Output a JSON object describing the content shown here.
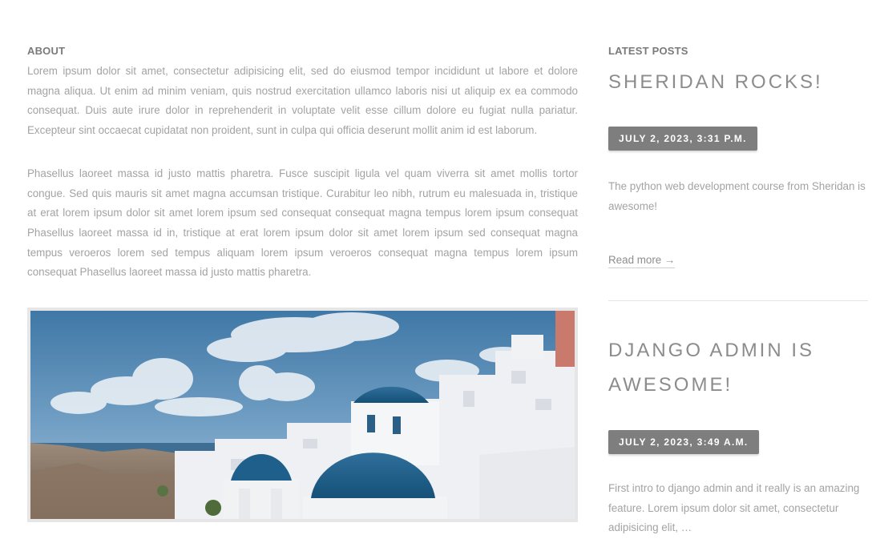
{
  "about": {
    "heading": "ABOUT",
    "paragraphs": [
      "Lorem ipsum dolor sit amet, consectetur adipisicing elit, sed do eiusmod tempor incididunt ut labore et dolore magna aliqua. Ut enim ad minim veniam, quis nostrud exercitation ullamco laboris nisi ut aliquip ex ea commodo consequat. Duis aute irure dolor in reprehenderit in voluptate velit esse cillum dolore eu fugiat nulla pariatur. Excepteur sint occaecat cupidatat non proident, sunt in culpa qui officia deserunt mollit anim id est laborum.",
      "Phasellus laoreet massa id justo mattis pharetra. Fusce suscipit ligula vel quam viverra sit amet mollis tortor congue. Sed quis mauris sit amet magna accumsan tristique. Curabitur leo nibh, rutrum eu malesuada in, tristique at erat lorem ipsum dolor sit amet lorem ipsum sed consequat consequat magna tempus lorem ipsum consequat Phasellus laoreet massa id in, tristique at erat lorem ipsum dolor sit amet lorem ipsum sed consequat magna tempus veroeros lorem sed tempus aliquam lorem ipsum veroeros consequat magna tempus lorem ipsum consequat Phasellus laoreet massa id justo mattis pharetra."
    ]
  },
  "latest_posts": {
    "heading": "LATEST POSTS",
    "posts": [
      {
        "title": "SHERIDAN ROCKS!",
        "date": "JULY 2, 2023, 3:31 P.M.",
        "excerpt": "The python web development course from Sheridan is awesome!",
        "read_more": "Read more →"
      },
      {
        "title": "DJANGO ADMIN IS AWESOME!",
        "date": "JULY 2, 2023, 3:49 A.M.",
        "excerpt": "First intro to django admin and it really is an amazing feature. Lorem ipsum dolor sit amet, consectetur adipisicing elit, …"
      }
    ]
  },
  "colors": {
    "badge_background": "#7e7e7e",
    "heading": "#7a7a7a",
    "body_text": "#a3a3a3",
    "image_border": "#e6e6e6"
  }
}
